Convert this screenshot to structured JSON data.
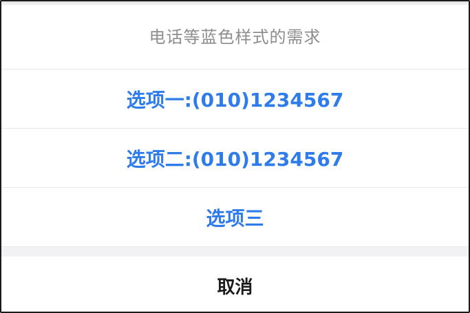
{
  "action_sheet": {
    "title": "电话等蓝色样式的需求",
    "options": [
      {
        "label": "选项一:(010)1234567"
      },
      {
        "label": "选项二:(010)1234567"
      },
      {
        "label": "选项三"
      }
    ],
    "cancel_label": "取消"
  },
  "colors": {
    "option_text": "#2e7bec",
    "title_text": "#8d8d8d",
    "cancel_text": "#1b1b1b",
    "divider": "#e7e7e7",
    "gap_background": "#f2f2f4",
    "frame_border": "#1a1a1a"
  }
}
